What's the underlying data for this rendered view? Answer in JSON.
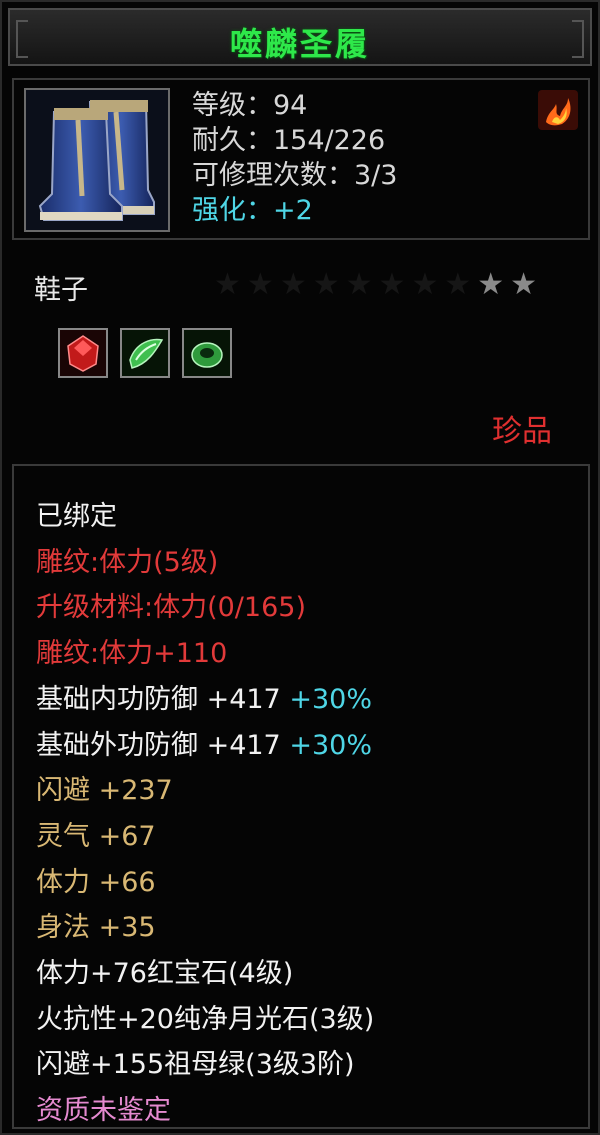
{
  "title": "噬麟圣履",
  "item": {
    "icon": "boots-icon",
    "level": "等级：94",
    "durability": "耐久：154/226",
    "repair_count": "可修理次数：3/3",
    "enhance": "强化：+2",
    "element_icon": "fire-icon"
  },
  "slot_label": "鞋子",
  "stars": {
    "total": 10,
    "lit": 2
  },
  "gems": [
    "red-gem-icon",
    "green-moonstone-icon",
    "green-jade-icon"
  ],
  "rarity": "珍品",
  "colors": {
    "title": "#2ee84a",
    "red": "#e23a3a",
    "gold": "#d9b874",
    "pink": "#e58ad0",
    "cyan": "#4fd6e6"
  },
  "details": {
    "bound": "已绑定",
    "engrave1": "雕纹:体力(5级)",
    "upgrade_material": "升级材料:体力(0/165)",
    "engrave2": "雕纹:体力+110",
    "inner_defense": {
      "label": "基础内功防御  +417",
      "bonus": "+30%"
    },
    "outer_defense": {
      "label": "基础外功防御  +417",
      "bonus": "+30%"
    },
    "dodge": "闪避  +237",
    "spirit": "灵气  +67",
    "stamina": "体力  +66",
    "agility": "身法  +35",
    "gem1": "体力+76红宝石(4级)",
    "gem2": "火抗性+20纯净月光石(3级)",
    "gem3": "闪避+155祖母绿(3级3阶)",
    "quality": "资质未鉴定"
  }
}
